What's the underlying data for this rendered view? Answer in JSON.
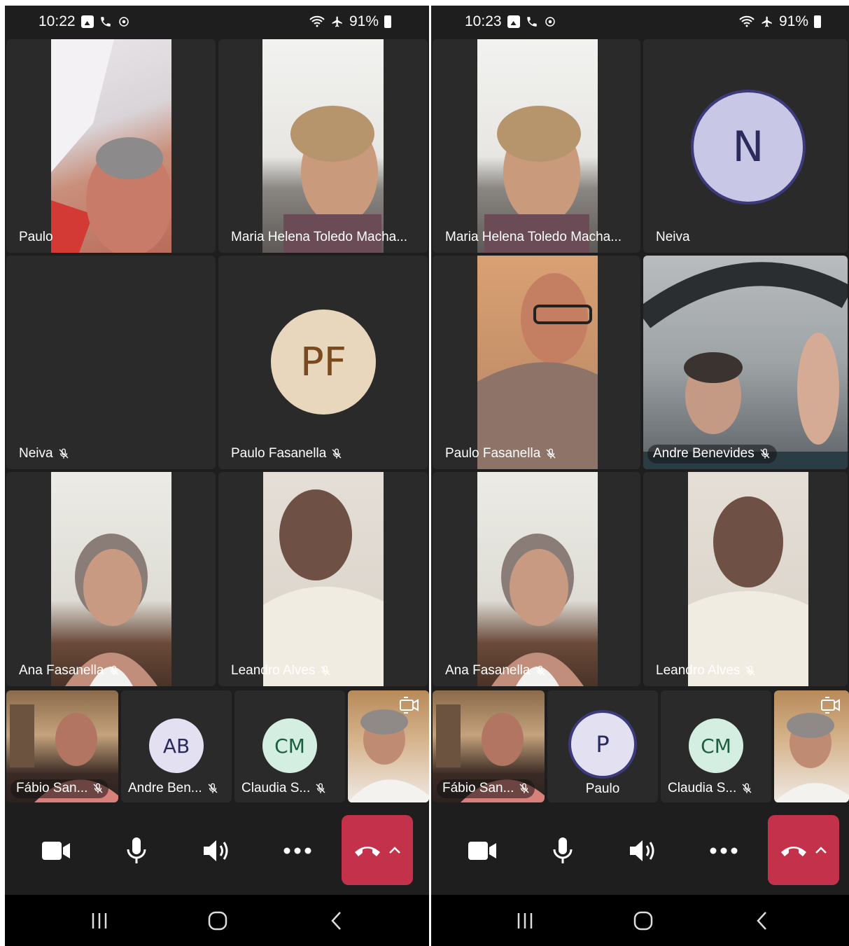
{
  "left": {
    "status": {
      "time": "10:22",
      "battery": "91%"
    },
    "tiles": {
      "paulo": {
        "name": "Paulo"
      },
      "maria": {
        "name": "Maria Helena Toledo Macha..."
      },
      "neiva": {
        "name": "Neiva"
      },
      "paulo_fasanella": {
        "name": "Paulo Fasanella",
        "initials": "PF"
      },
      "ana": {
        "name": "Ana Fasanella"
      },
      "leandro": {
        "name": "Leandro Alves"
      }
    },
    "strip": {
      "fabio": {
        "name": "Fábio San..."
      },
      "andre": {
        "name": "Andre Ben...",
        "initials": "AB"
      },
      "claudia": {
        "name": "Claudia S...",
        "initials": "CM"
      }
    }
  },
  "right": {
    "status": {
      "time": "10:23",
      "battery": "91%"
    },
    "tiles": {
      "maria": {
        "name": "Maria Helena Toledo Macha..."
      },
      "neiva": {
        "name": "Neiva",
        "initials": "N"
      },
      "paulo_fasanella": {
        "name": "Paulo Fasanella"
      },
      "andre": {
        "name": "Andre Benevides"
      },
      "ana": {
        "name": "Ana Fasanella"
      },
      "leandro": {
        "name": "Leandro Alves"
      }
    },
    "strip": {
      "fabio": {
        "name": "Fábio San..."
      },
      "paulo": {
        "name": "Paulo",
        "initials": "P"
      },
      "claudia": {
        "name": "Claudia S...",
        "initials": "CM"
      }
    }
  },
  "colors": {
    "background": "#1e1e1e",
    "tile": "#2a2a2a",
    "leave": "#c4314b",
    "avatar_pf": "#e8d6bd",
    "avatar_ab": "#e3e0f2",
    "avatar_cm": "#d4efe2",
    "avatar_n": "#c9c7e6"
  },
  "icons": [
    "photo-icon",
    "phone-icon",
    "location-icon",
    "wifi-icon",
    "airplane-icon",
    "battery-icon",
    "mic-off-icon",
    "camera-icon",
    "microphone-icon",
    "speaker-icon",
    "more-icon",
    "hang-up-icon",
    "chevron-up-icon",
    "switch-camera-icon",
    "recents-icon",
    "home-icon",
    "back-icon"
  ]
}
